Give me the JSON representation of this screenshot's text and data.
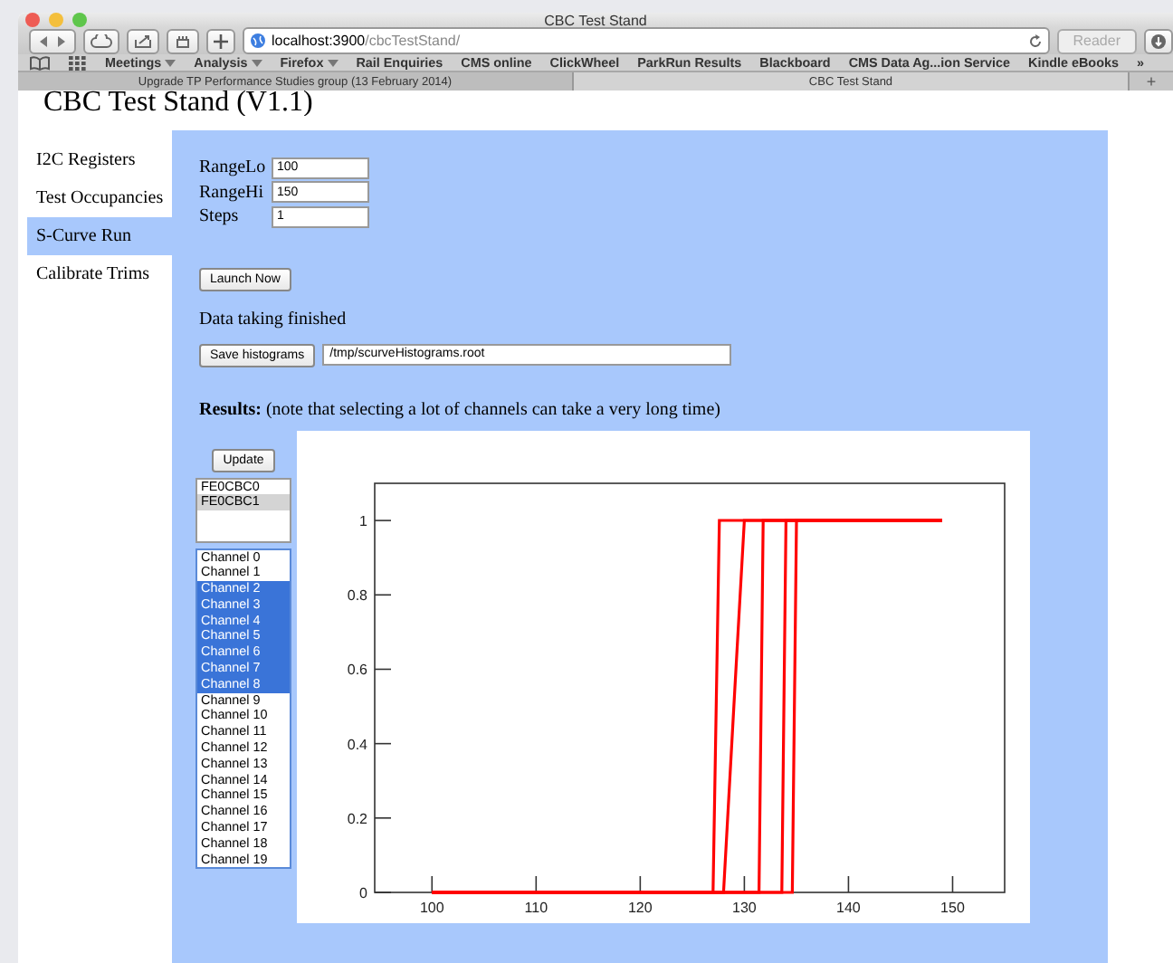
{
  "browser": {
    "title": "CBC Test Stand",
    "url_host": "localhost:3900",
    "url_path": "/cbcTestStand/",
    "reader": "Reader",
    "bookmarks": [
      {
        "label": "Meetings",
        "dropdown": true
      },
      {
        "label": "Analysis",
        "dropdown": true
      },
      {
        "label": "Firefox",
        "dropdown": true
      },
      {
        "label": "Rail Enquiries",
        "dropdown": false
      },
      {
        "label": "CMS online",
        "dropdown": false
      },
      {
        "label": "ClickWheel",
        "dropdown": false
      },
      {
        "label": "ParkRun Results",
        "dropdown": false
      },
      {
        "label": "Blackboard",
        "dropdown": false
      },
      {
        "label": "CMS Data Ag...ion Service",
        "dropdown": false
      },
      {
        "label": "Kindle eBooks",
        "dropdown": false
      }
    ],
    "more": "»",
    "tabs": [
      {
        "label": "Upgrade TP Performance Studies group (13 February 2014)",
        "selected": false
      },
      {
        "label": "CBC Test Stand",
        "selected": true
      }
    ],
    "new_tab": "+"
  },
  "page": {
    "heading": "CBC Test Stand (V1.1)",
    "nav": [
      {
        "label": "I2C Registers",
        "selected": false
      },
      {
        "label": "Test Occupancies",
        "selected": false
      },
      {
        "label": "S-Curve Run",
        "selected": true
      },
      {
        "label": "Calibrate Trims",
        "selected": false
      }
    ],
    "fields": [
      {
        "label": "RangeLo",
        "value": "100"
      },
      {
        "label": "RangeHi",
        "value": "150"
      },
      {
        "label": "Steps",
        "value": "1"
      }
    ],
    "launch_button": "Launch Now",
    "status": "Data taking finished",
    "save_button": "Save histograms",
    "save_path": "/tmp/scurveHistograms.root",
    "results_label": "Results:",
    "results_note": "(note that selecting a lot of channels can take a very long time)",
    "update_button": "Update",
    "boards": [
      {
        "label": "FE0CBC0",
        "selected": false
      },
      {
        "label": "FE0CBC1",
        "selected": true
      }
    ],
    "channels": [
      {
        "label": "Channel 0",
        "selected": false
      },
      {
        "label": "Channel 1",
        "selected": false
      },
      {
        "label": "Channel 2",
        "selected": true
      },
      {
        "label": "Channel 3",
        "selected": true
      },
      {
        "label": "Channel 4",
        "selected": true
      },
      {
        "label": "Channel 5",
        "selected": true
      },
      {
        "label": "Channel 6",
        "selected": true
      },
      {
        "label": "Channel 7",
        "selected": true
      },
      {
        "label": "Channel 8",
        "selected": true
      },
      {
        "label": "Channel 9",
        "selected": false
      },
      {
        "label": "Channel 10",
        "selected": false
      },
      {
        "label": "Channel 11",
        "selected": false
      },
      {
        "label": "Channel 12",
        "selected": false
      },
      {
        "label": "Channel 13",
        "selected": false
      },
      {
        "label": "Channel 14",
        "selected": false
      },
      {
        "label": "Channel 15",
        "selected": false
      },
      {
        "label": "Channel 16",
        "selected": false
      },
      {
        "label": "Channel 17",
        "selected": false
      },
      {
        "label": "Channel 18",
        "selected": false
      },
      {
        "label": "Channel 19",
        "selected": false
      }
    ],
    "chart_data": {
      "type": "line",
      "x": [
        100,
        127,
        127.6,
        128,
        129,
        130,
        131.4,
        131.8,
        133.6,
        134,
        134.6,
        135,
        149
      ],
      "xlim": [
        94.5,
        155
      ],
      "ylim": [
        0,
        1.1
      ],
      "xticks": [
        100,
        110,
        120,
        130,
        140,
        150
      ],
      "yticks": [
        0,
        0.2,
        0.4,
        0.6,
        0.8,
        1
      ],
      "series": [
        {
          "color": "#ff0000",
          "values": [
            0,
            0,
            1,
            1,
            1,
            1,
            1,
            1,
            1,
            1,
            1,
            1,
            1
          ]
        },
        {
          "color": "#ff0000",
          "values": [
            0,
            0,
            0,
            0,
            0.5,
            1,
            1,
            1,
            1,
            1,
            1,
            1,
            1
          ]
        },
        {
          "color": "#ff0000",
          "values": [
            0,
            0,
            0,
            0,
            0,
            0,
            0,
            1,
            1,
            1,
            1,
            1,
            1
          ]
        },
        {
          "color": "#ff0000",
          "values": [
            0,
            0,
            0,
            0,
            0,
            0,
            0,
            0,
            0,
            1,
            1,
            1,
            1
          ]
        },
        {
          "color": "#ff0000",
          "values": [
            0,
            0,
            0,
            0,
            0,
            0,
            0,
            0,
            0,
            0,
            0,
            1,
            1
          ]
        }
      ]
    }
  }
}
